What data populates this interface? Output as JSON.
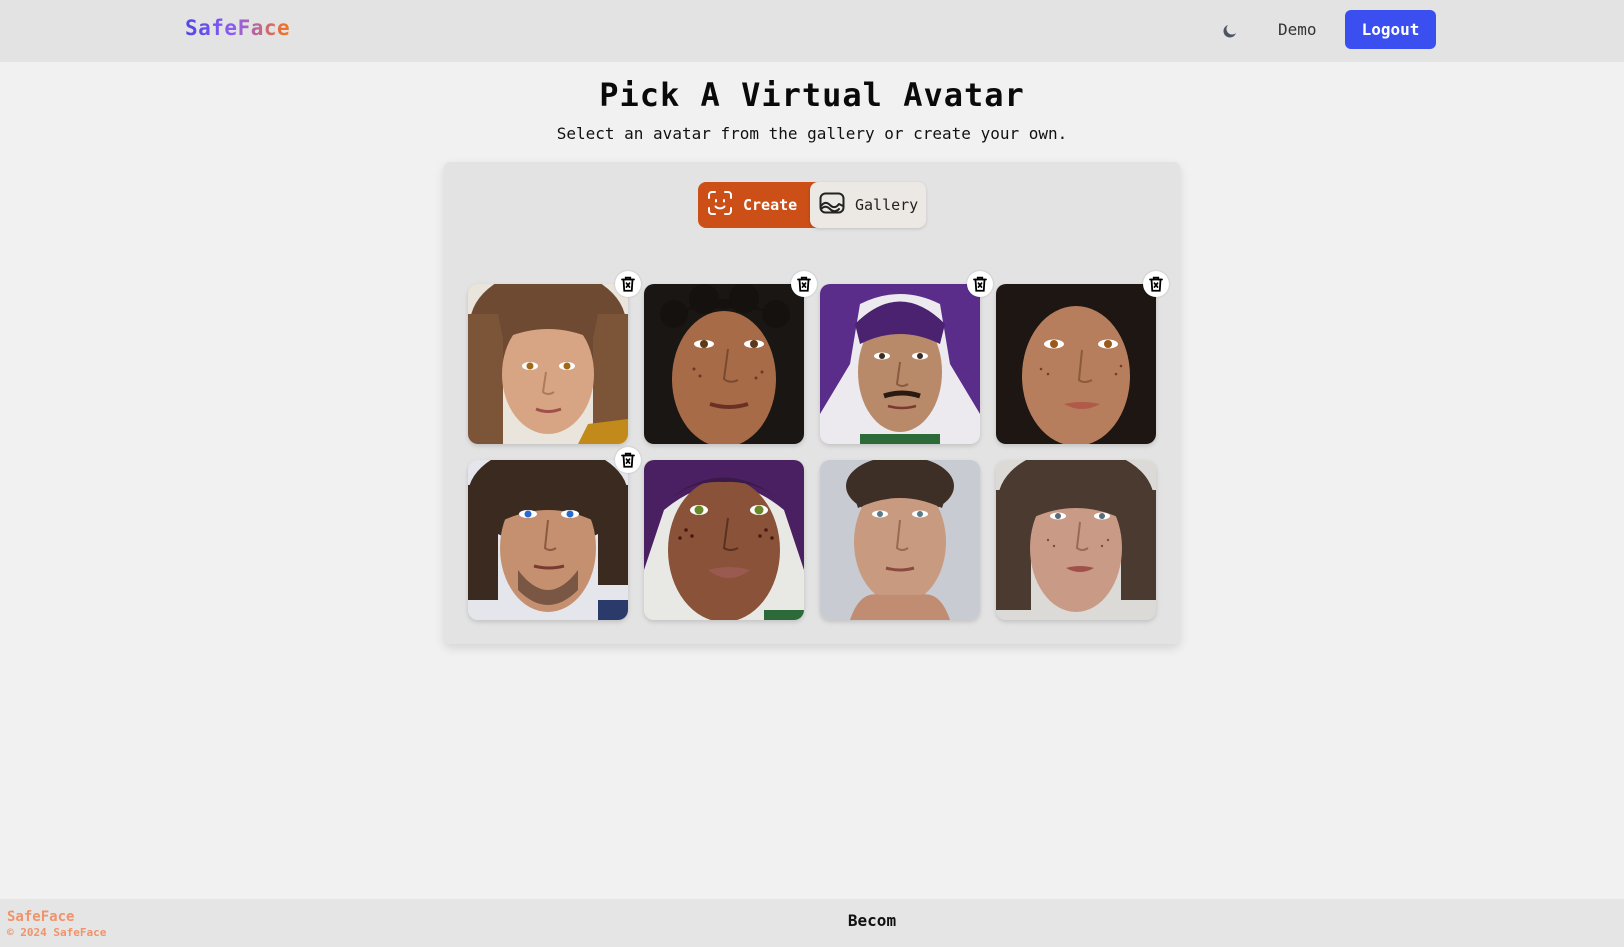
{
  "navbar": {
    "brand": "SafeFace",
    "theme_toggle_icon": "moon-icon",
    "demo_label": "Demo",
    "logout_label": "Logout",
    "logout_color": "#3b4ff0"
  },
  "main": {
    "title": "Pick A Virtual Avatar",
    "subtitle": "Select an avatar from the gallery or create your own."
  },
  "tabs": {
    "create_label": "Create",
    "create_icon": "face-scan-icon",
    "gallery_label": "Gallery",
    "gallery_icon": "image-icon",
    "active": "Create",
    "active_color": "#cb4f17"
  },
  "avatars": [
    {
      "name": "avatar-1",
      "deletable": true,
      "description_colors": [
        "#8a5a3c",
        "#d9a07a"
      ]
    },
    {
      "name": "avatar-2",
      "deletable": true,
      "description_colors": [
        "#1e1a18",
        "#9a6546"
      ]
    },
    {
      "name": "avatar-3",
      "deletable": true,
      "description_colors": [
        "#5b2d8a",
        "#b88868"
      ]
    },
    {
      "name": "avatar-4",
      "deletable": true,
      "description_colors": [
        "#2a1e18",
        "#b07a58"
      ]
    },
    {
      "name": "avatar-5",
      "deletable": true,
      "description_colors": [
        "#3b2a20",
        "#c49070"
      ]
    },
    {
      "name": "avatar-6",
      "deletable": false,
      "description_colors": [
        "#5a2a70",
        "#8a5238"
      ]
    },
    {
      "name": "avatar-7",
      "deletable": false,
      "description_colors": [
        "#3d2e26",
        "#c89a80"
      ]
    },
    {
      "name": "avatar-8",
      "deletable": false,
      "description_colors": [
        "#4a3a30",
        "#c99a86"
      ]
    }
  ],
  "footer": {
    "brand": "SafeFace",
    "copyright": "© 2024 SafeFace",
    "center_text": "Becom"
  }
}
